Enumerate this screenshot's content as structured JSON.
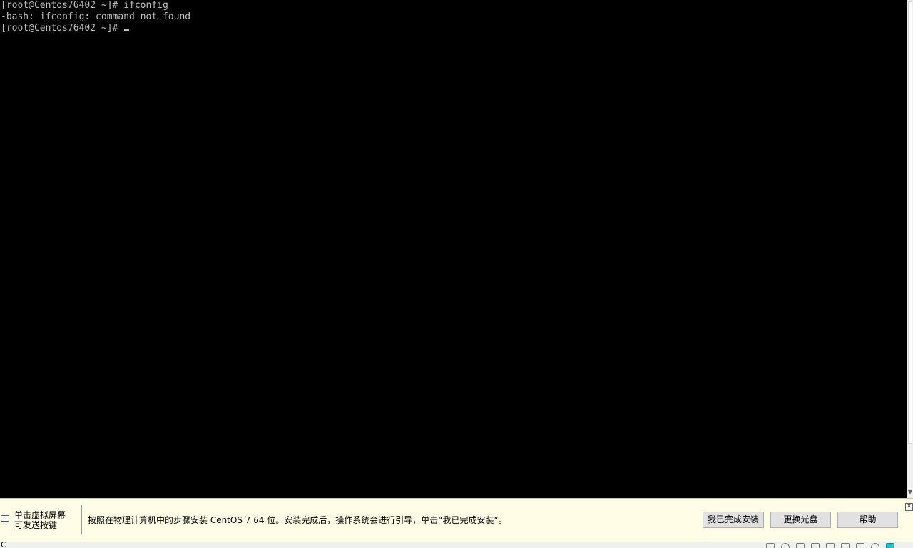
{
  "console": {
    "lines": [
      "[root@Centos76402 ~]# ifconfig",
      "-bash: ifconfig: command not found",
      "[root@Centos76402 ~]# "
    ],
    "text_color": "#bfbfbf",
    "background": "#000000"
  },
  "hint_bar": {
    "left_line1": "单击虚拟屏幕",
    "left_line2": "可发送按键",
    "message": "按照在物理计算机中的步骤安装 CentOS 7 64 位。安装完成后，操作系统会进行引导，单击“我已完成安装”。",
    "buttons": {
      "done_install": "我已完成安装",
      "change_disc": "更换光盘",
      "help": "帮助"
    },
    "background": "#fffde6"
  },
  "status_bar": {
    "left_text": "C",
    "icons": [
      "hard-disk-icon",
      "cd-dvd-icon",
      "network-icon",
      "usb-icon",
      "sound-icon",
      "printer-icon",
      "display-icon",
      "camera-icon",
      "connection-icon"
    ]
  }
}
